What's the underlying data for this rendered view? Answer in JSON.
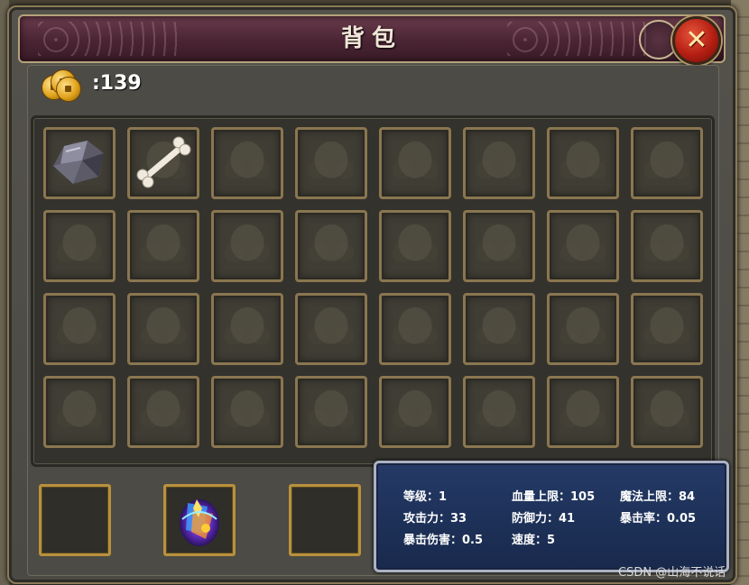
{
  "window": {
    "title": "背包",
    "close_icon": "close-icon"
  },
  "currency": {
    "icon": "gold-coins-icon",
    "label": ":139"
  },
  "inventory": {
    "rows": 4,
    "columns": 8,
    "items": [
      {
        "icon": "ore-stone-icon"
      },
      {
        "icon": "bone-icon"
      }
    ]
  },
  "equipment_slots": [
    {
      "icon": ""
    },
    {
      "icon": "magic-crystal-icon"
    },
    {
      "icon": ""
    }
  ],
  "stats": {
    "level": "等级：1",
    "hp_max": "血量上限：105",
    "mp_max": "魔法上限：84",
    "attack": "攻击力：33",
    "defense": "防御力：41",
    "crit_rate": "暴击率：0.05",
    "crit_damage": "暴击伤害：0.5",
    "speed": "速度：5"
  },
  "watermark": "CSDN @山海不说话",
  "colors": {
    "title_bar": "#4a2433",
    "stats_panel": "#1f3159",
    "slot_border": "#8a7650",
    "equip_border": "#b9913c",
    "close_button": "#c0281a"
  }
}
